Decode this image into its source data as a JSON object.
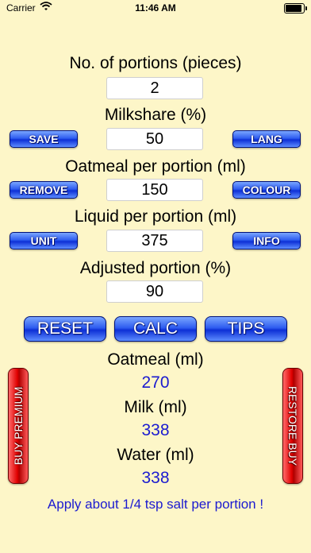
{
  "status_bar": {
    "carrier": "Carrier",
    "time": "11:46 AM",
    "wifi_icon": "wifi-icon",
    "battery_icon": "battery-icon"
  },
  "form": {
    "portions_label": "No. of portions (pieces)",
    "portions_value": "2",
    "milkshare_label": "Milkshare (%)",
    "milkshare_value": "50",
    "oatmeal_label": "Oatmeal per portion (ml)",
    "oatmeal_value": "150",
    "liquid_label": "Liquid per portion (ml)",
    "liquid_value": "375",
    "adjusted_label": "Adjusted portion (%)",
    "adjusted_value": "90"
  },
  "side_buttons": {
    "save": "SAVE",
    "lang": "LANG",
    "remove": "REMOVE",
    "colour": "COLOUR",
    "unit": "UNIT",
    "info": "INFO"
  },
  "actions": {
    "reset": "RESET",
    "calc": "CALC",
    "tips": "TIPS"
  },
  "results": {
    "oatmeal_label": "Oatmeal (ml)",
    "oatmeal_value": "270",
    "milk_label": "Milk (ml)",
    "milk_value": "338",
    "water_label": "Water (ml)",
    "water_value": "338"
  },
  "purchase": {
    "buy_premium": "BUY PREMIUM",
    "restore_buy": "RESTORE BUY"
  },
  "tip_text": "Apply about 1/4 tsp salt per portion !",
  "colors": {
    "background": "#fdf6c8",
    "button_blue": "#2f5df0",
    "button_red": "#e00000",
    "result_blue": "#1b1bd0"
  }
}
